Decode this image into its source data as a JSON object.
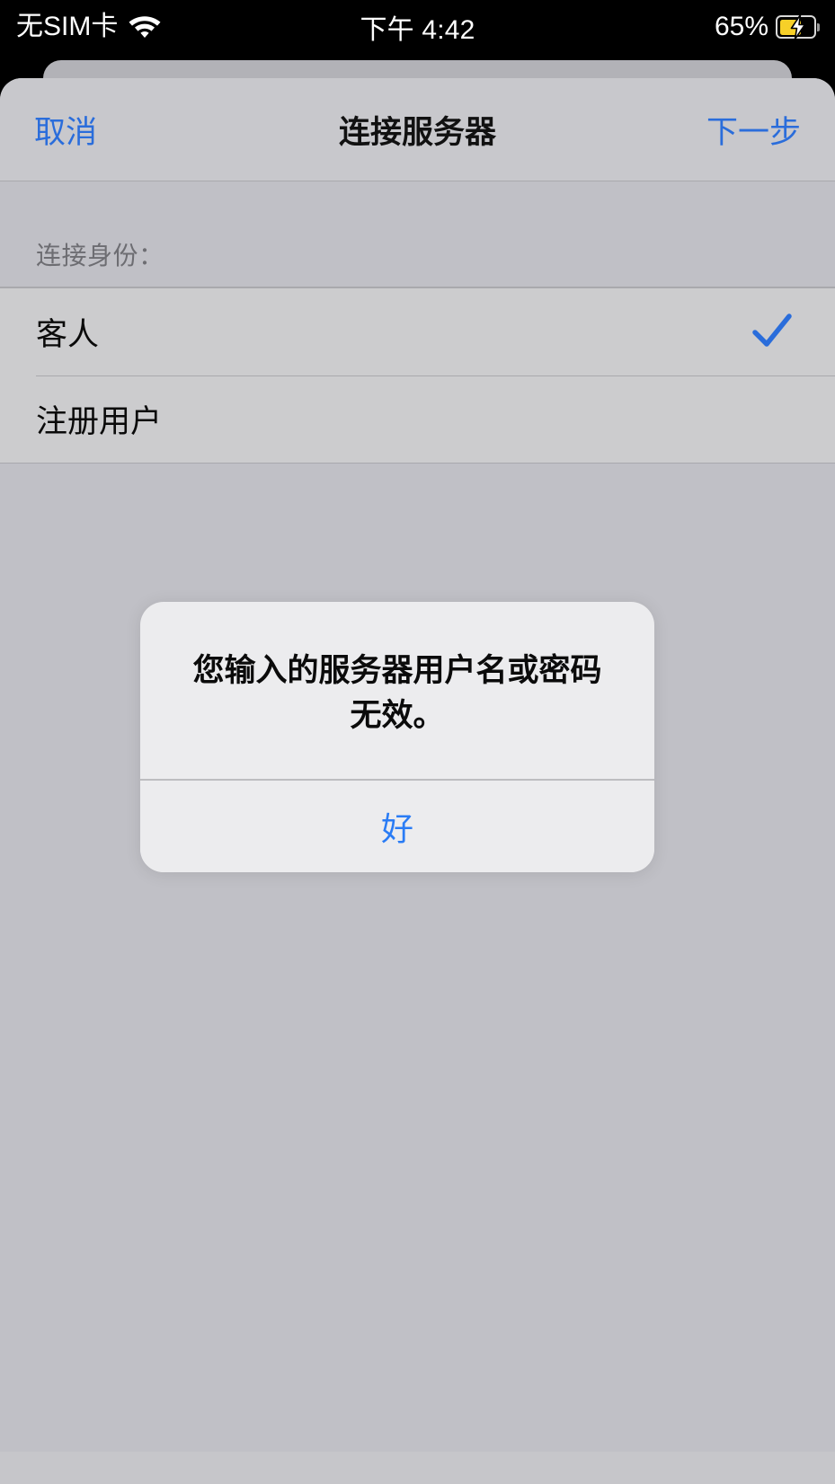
{
  "status_bar": {
    "carrier": "无SIM卡",
    "wifi_icon": "wifi-icon",
    "time": "下午 4:42",
    "battery_percent": "65%",
    "battery_level": 65,
    "battery_state": "charging",
    "battery_fill_color": "#f7d028",
    "background_color": "#000000",
    "text_color": "#ffffff"
  },
  "sheet": {
    "background_color": "#c6c6ca",
    "rear_sheet_color": "#b2b2b7"
  },
  "navbar": {
    "cancel_label": "取消",
    "title": "连接服务器",
    "next_label": "下一步",
    "tint_color": "#2a6ddb",
    "background_color": "#c8c8cc"
  },
  "table": {
    "section_header": "连接身份：",
    "rows": [
      {
        "label": "客人",
        "selected": true,
        "checkmark_icon": "checkmark-icon"
      },
      {
        "label": "注册用户",
        "selected": false,
        "checkmark_icon": "checkmark-icon"
      }
    ],
    "row_background_color": "#ccccce",
    "table_background_color": "#c0c0c6",
    "separator_color": "#a9a9ad",
    "header_text_color": "#6d6d72"
  },
  "alert": {
    "message": "您输入的服务器用户名或密码无效。",
    "ok_label": "好",
    "background_color": "#ececee",
    "button_tint_color": "#2a7cf5"
  }
}
